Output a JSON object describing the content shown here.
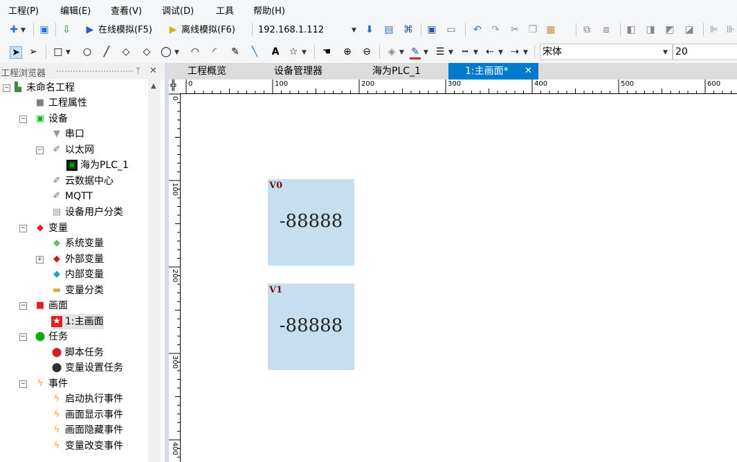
{
  "menu": [
    "工程(P)",
    "编辑(E)",
    "查看(V)",
    "调试(D)",
    "工具",
    "帮助(H)"
  ],
  "toolbar": {
    "online_sim": "在线模拟(F5)",
    "offline_sim": "离线模拟(F6)",
    "ip": "192.168.1.112",
    "font_name": "宋体",
    "font_size": "20"
  },
  "explorer": {
    "title": "工程浏览器",
    "pin": "ᛘ",
    "close": "✕",
    "tree": [
      {
        "label": "未命名工程",
        "icon": "project-icon",
        "color": "#3c8c3c"
      },
      {
        "label": "工程属性",
        "icon": "properties-icon",
        "color": "#808080"
      },
      {
        "label": "设备",
        "icon": "device-icon",
        "color": "#00c000"
      },
      {
        "label": "串口",
        "icon": "serial-port-icon",
        "color": "#999999"
      },
      {
        "label": "以太网",
        "icon": "ethernet-icon",
        "color": "#707070"
      },
      {
        "label": "海为PLC_1",
        "icon": "plc-icon",
        "color": "#00a000"
      },
      {
        "label": "云数据中心",
        "icon": "cloud-data-icon",
        "color": "#707070"
      },
      {
        "label": "MQTT",
        "icon": "mqtt-icon",
        "color": "#707070"
      },
      {
        "label": "设备用户分类",
        "icon": "user-category-icon",
        "color": "#909090"
      },
      {
        "label": "变量",
        "icon": "variables-icon",
        "color": "#e02020"
      },
      {
        "label": "系统变量",
        "icon": "system-variable-icon",
        "color": "#60c060"
      },
      {
        "label": "外部变量",
        "icon": "external-variable-icon",
        "color": "#c02020"
      },
      {
        "label": "内部变量",
        "icon": "internal-variable-icon",
        "color": "#20a0e0"
      },
      {
        "label": "变量分类",
        "icon": "variable-category-icon",
        "color": "#d0b040"
      },
      {
        "label": "画面",
        "icon": "screens-icon",
        "color": "#e02020"
      },
      {
        "label": "1:主画面",
        "icon": "main-screen-icon",
        "color": "#e02020"
      },
      {
        "label": "任务",
        "icon": "tasks-icon",
        "color": "#00b000"
      },
      {
        "label": "脚本任务",
        "icon": "script-task-icon",
        "color": "#d02020"
      },
      {
        "label": "变量设置任务",
        "icon": "variable-set-task-icon",
        "color": "#303030"
      },
      {
        "label": "事件",
        "icon": "events-icon",
        "color": "#f0a020"
      },
      {
        "label": "启动执行事件",
        "icon": "startup-event-icon",
        "color": "#f0a020"
      },
      {
        "label": "画面显示事件",
        "icon": "screen-show-event-icon",
        "color": "#f0a020"
      },
      {
        "label": "画面隐藏事件",
        "icon": "screen-hide-event-icon",
        "color": "#f0a020"
      },
      {
        "label": "变量改变事件",
        "icon": "variable-change-event-icon",
        "color": "#f0a020"
      }
    ]
  },
  "tabs": [
    {
      "label": "工程概览",
      "active": false
    },
    {
      "label": "设备管理器",
      "active": false
    },
    {
      "label": "海为PLC_1",
      "active": false
    },
    {
      "label": "1:主画面*",
      "active": true
    }
  ],
  "tab_close": "✕",
  "ruler": {
    "h_labels": [
      "0",
      "100",
      "200",
      "300",
      "400",
      "500",
      "600"
    ],
    "v_labels": [
      "0",
      "100",
      "200",
      "300",
      "400"
    ]
  },
  "widgets": [
    {
      "label": "V0",
      "value": "-88888"
    },
    {
      "label": "V1",
      "value": "-88888"
    }
  ],
  "colors": {
    "accent": "#007acc",
    "widget_fill": "#c5dff0",
    "widget_label": "#7a0e0e"
  }
}
